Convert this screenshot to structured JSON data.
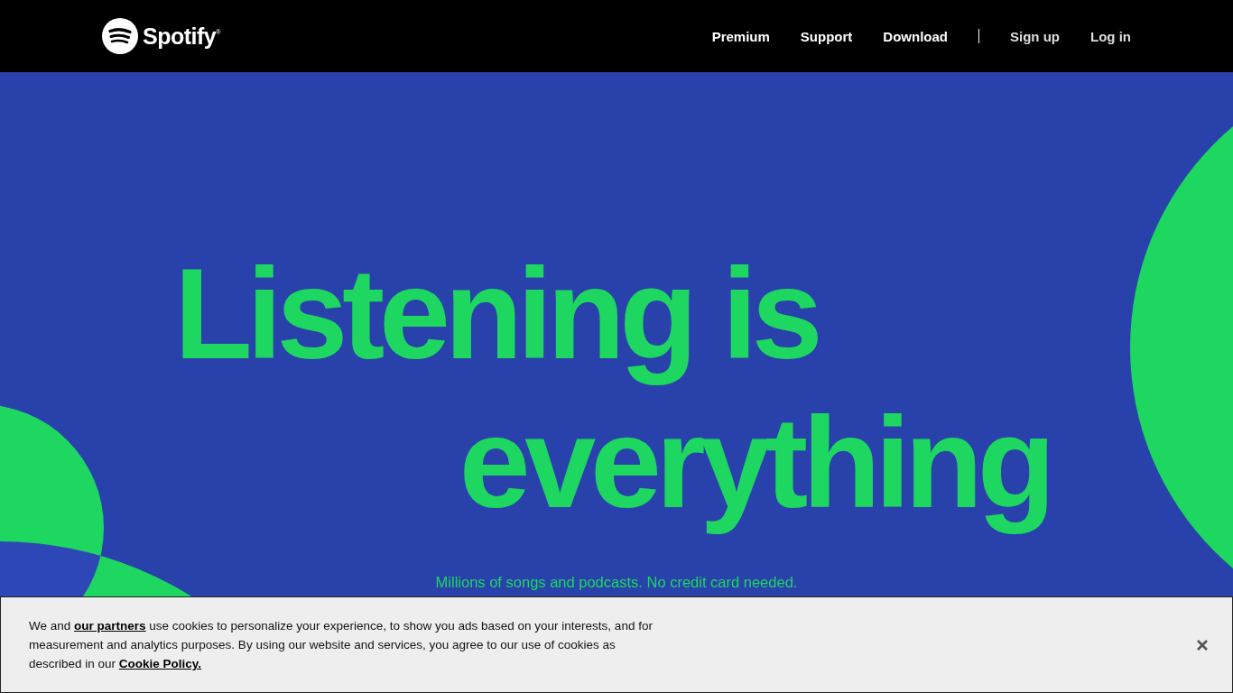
{
  "header": {
    "brand": "Spotify",
    "brand_mark": "®",
    "nav": [
      "Premium",
      "Support",
      "Download"
    ],
    "account": [
      "Sign up",
      "Log in"
    ]
  },
  "hero": {
    "headline": [
      "Listening is",
      "everything"
    ],
    "subtitle": "Millions of songs and podcasts. No credit card needed."
  },
  "cookie_banner": {
    "parts": [
      {
        "kind": "text",
        "text": "We and"
      },
      {
        "kind": "link",
        "text": "our partners"
      },
      {
        "kind": "text",
        "text": "use cookies to personalize your experience, to show you ads based on your interests, and for measurement and analytics purposes. By using our website and services, you agree to our use of cookies as described in our"
      },
      {
        "kind": "link",
        "text": "Cookie Policy."
      }
    ]
  }
}
